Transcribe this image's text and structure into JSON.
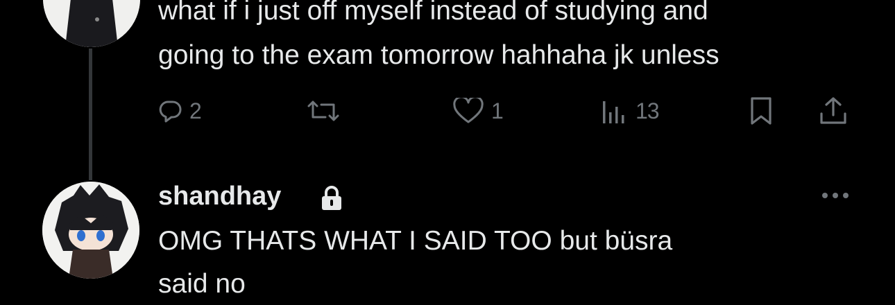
{
  "post1": {
    "text_line1": "what if i just off myself instead of studying and",
    "text_line2": "going to the exam tomorrow hahhaha jk unless",
    "actions": {
      "reply_count": "2",
      "repost_count": "",
      "like_count": "1",
      "views_count": "13"
    }
  },
  "post2": {
    "username": "shandhay",
    "text_line1": "OMG THATS WHAT I SAID TOO but büsra",
    "text_line2": "said no"
  },
  "colors": {
    "background": "#000000",
    "text": "#e7e9ea",
    "muted": "#71767b",
    "thread_line": "#333639"
  }
}
